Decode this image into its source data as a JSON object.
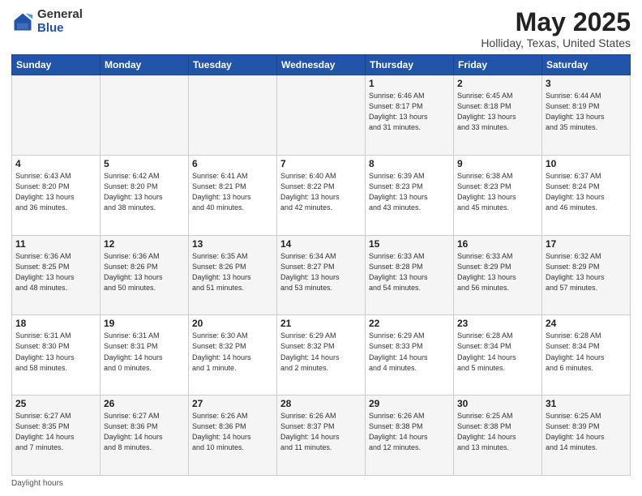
{
  "logo": {
    "general": "General",
    "blue": "Blue"
  },
  "title": "May 2025",
  "location": "Holliday, Texas, United States",
  "days_of_week": [
    "Sunday",
    "Monday",
    "Tuesday",
    "Wednesday",
    "Thursday",
    "Friday",
    "Saturday"
  ],
  "footer": "Daylight hours",
  "weeks": [
    [
      {
        "day": "",
        "info": ""
      },
      {
        "day": "",
        "info": ""
      },
      {
        "day": "",
        "info": ""
      },
      {
        "day": "",
        "info": ""
      },
      {
        "day": "1",
        "info": "Sunrise: 6:46 AM\nSunset: 8:17 PM\nDaylight: 13 hours\nand 31 minutes."
      },
      {
        "day": "2",
        "info": "Sunrise: 6:45 AM\nSunset: 8:18 PM\nDaylight: 13 hours\nand 33 minutes."
      },
      {
        "day": "3",
        "info": "Sunrise: 6:44 AM\nSunset: 8:19 PM\nDaylight: 13 hours\nand 35 minutes."
      }
    ],
    [
      {
        "day": "4",
        "info": "Sunrise: 6:43 AM\nSunset: 8:20 PM\nDaylight: 13 hours\nand 36 minutes."
      },
      {
        "day": "5",
        "info": "Sunrise: 6:42 AM\nSunset: 8:20 PM\nDaylight: 13 hours\nand 38 minutes."
      },
      {
        "day": "6",
        "info": "Sunrise: 6:41 AM\nSunset: 8:21 PM\nDaylight: 13 hours\nand 40 minutes."
      },
      {
        "day": "7",
        "info": "Sunrise: 6:40 AM\nSunset: 8:22 PM\nDaylight: 13 hours\nand 42 minutes."
      },
      {
        "day": "8",
        "info": "Sunrise: 6:39 AM\nSunset: 8:23 PM\nDaylight: 13 hours\nand 43 minutes."
      },
      {
        "day": "9",
        "info": "Sunrise: 6:38 AM\nSunset: 8:23 PM\nDaylight: 13 hours\nand 45 minutes."
      },
      {
        "day": "10",
        "info": "Sunrise: 6:37 AM\nSunset: 8:24 PM\nDaylight: 13 hours\nand 46 minutes."
      }
    ],
    [
      {
        "day": "11",
        "info": "Sunrise: 6:36 AM\nSunset: 8:25 PM\nDaylight: 13 hours\nand 48 minutes."
      },
      {
        "day": "12",
        "info": "Sunrise: 6:36 AM\nSunset: 8:26 PM\nDaylight: 13 hours\nand 50 minutes."
      },
      {
        "day": "13",
        "info": "Sunrise: 6:35 AM\nSunset: 8:26 PM\nDaylight: 13 hours\nand 51 minutes."
      },
      {
        "day": "14",
        "info": "Sunrise: 6:34 AM\nSunset: 8:27 PM\nDaylight: 13 hours\nand 53 minutes."
      },
      {
        "day": "15",
        "info": "Sunrise: 6:33 AM\nSunset: 8:28 PM\nDaylight: 13 hours\nand 54 minutes."
      },
      {
        "day": "16",
        "info": "Sunrise: 6:33 AM\nSunset: 8:29 PM\nDaylight: 13 hours\nand 56 minutes."
      },
      {
        "day": "17",
        "info": "Sunrise: 6:32 AM\nSunset: 8:29 PM\nDaylight: 13 hours\nand 57 minutes."
      }
    ],
    [
      {
        "day": "18",
        "info": "Sunrise: 6:31 AM\nSunset: 8:30 PM\nDaylight: 13 hours\nand 58 minutes."
      },
      {
        "day": "19",
        "info": "Sunrise: 6:31 AM\nSunset: 8:31 PM\nDaylight: 14 hours\nand 0 minutes."
      },
      {
        "day": "20",
        "info": "Sunrise: 6:30 AM\nSunset: 8:32 PM\nDaylight: 14 hours\nand 1 minute."
      },
      {
        "day": "21",
        "info": "Sunrise: 6:29 AM\nSunset: 8:32 PM\nDaylight: 14 hours\nand 2 minutes."
      },
      {
        "day": "22",
        "info": "Sunrise: 6:29 AM\nSunset: 8:33 PM\nDaylight: 14 hours\nand 4 minutes."
      },
      {
        "day": "23",
        "info": "Sunrise: 6:28 AM\nSunset: 8:34 PM\nDaylight: 14 hours\nand 5 minutes."
      },
      {
        "day": "24",
        "info": "Sunrise: 6:28 AM\nSunset: 8:34 PM\nDaylight: 14 hours\nand 6 minutes."
      }
    ],
    [
      {
        "day": "25",
        "info": "Sunrise: 6:27 AM\nSunset: 8:35 PM\nDaylight: 14 hours\nand 7 minutes."
      },
      {
        "day": "26",
        "info": "Sunrise: 6:27 AM\nSunset: 8:36 PM\nDaylight: 14 hours\nand 8 minutes."
      },
      {
        "day": "27",
        "info": "Sunrise: 6:26 AM\nSunset: 8:36 PM\nDaylight: 14 hours\nand 10 minutes."
      },
      {
        "day": "28",
        "info": "Sunrise: 6:26 AM\nSunset: 8:37 PM\nDaylight: 14 hours\nand 11 minutes."
      },
      {
        "day": "29",
        "info": "Sunrise: 6:26 AM\nSunset: 8:38 PM\nDaylight: 14 hours\nand 12 minutes."
      },
      {
        "day": "30",
        "info": "Sunrise: 6:25 AM\nSunset: 8:38 PM\nDaylight: 14 hours\nand 13 minutes."
      },
      {
        "day": "31",
        "info": "Sunrise: 6:25 AM\nSunset: 8:39 PM\nDaylight: 14 hours\nand 14 minutes."
      }
    ]
  ]
}
